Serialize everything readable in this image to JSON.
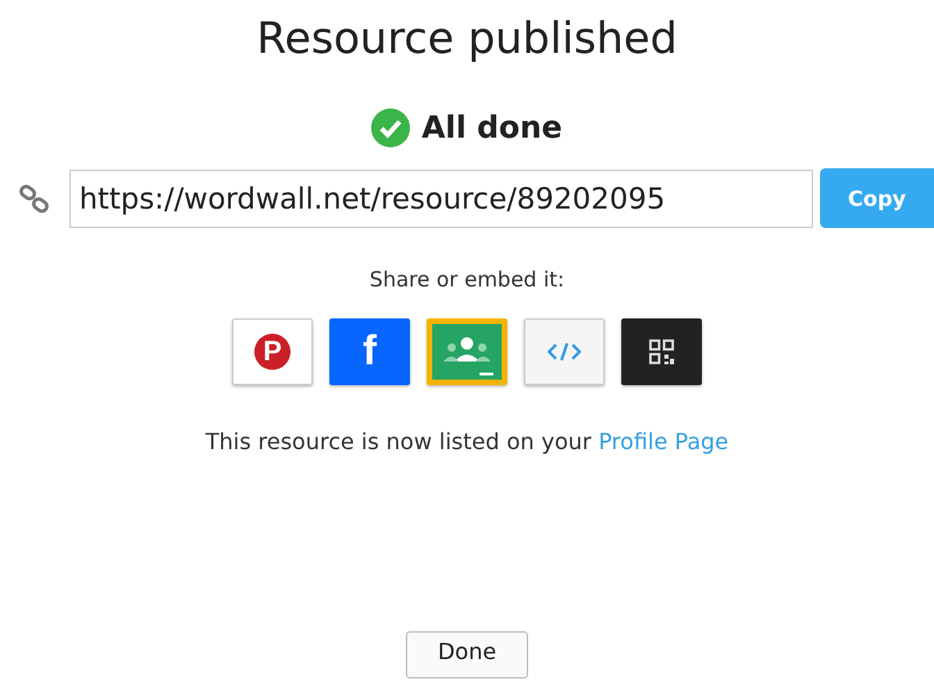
{
  "title": "Resource published",
  "status": "All done",
  "link": {
    "value": "https://wordwall.net/resource/89202095",
    "button": "Copy"
  },
  "share_label": "Share or embed it:",
  "share_buttons": [
    {
      "kind": "pinterest",
      "glyph": "P"
    },
    {
      "kind": "facebook",
      "glyph": "f"
    },
    {
      "kind": "classroom"
    },
    {
      "kind": "embed"
    },
    {
      "kind": "qr"
    }
  ],
  "listed": {
    "text": "This resource is now listed on your",
    "link": "Profile Page"
  },
  "done_button": "Done"
}
